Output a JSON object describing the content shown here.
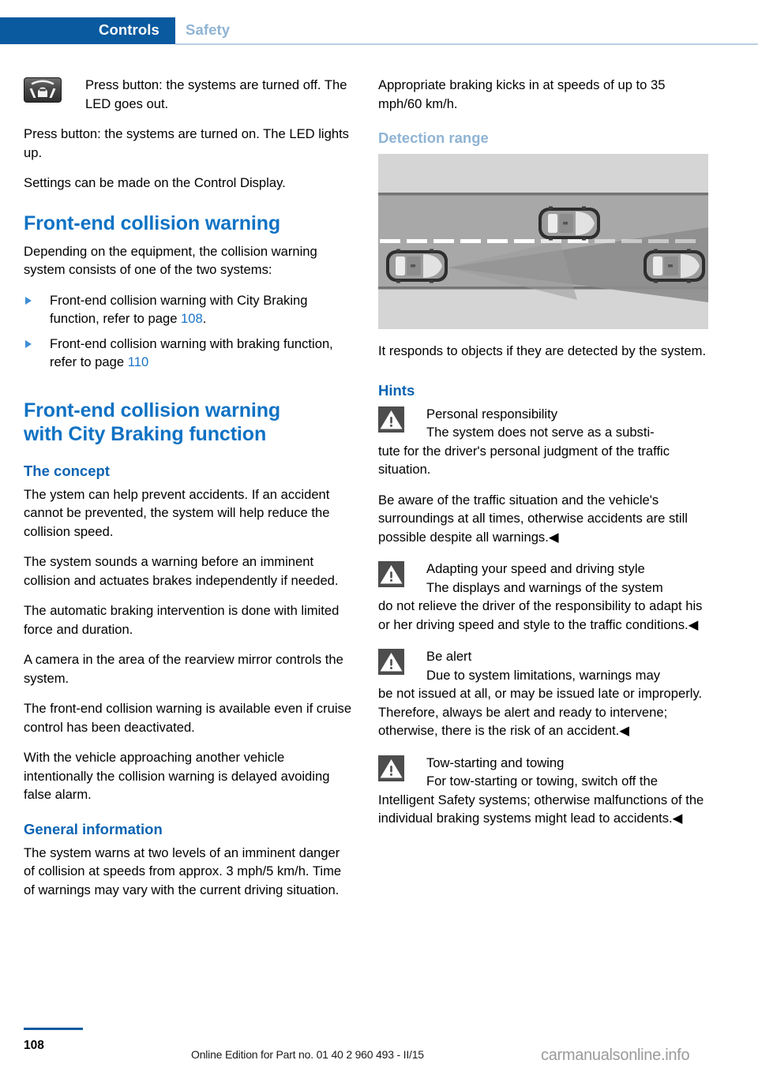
{
  "header": {
    "tab_active": "Controls",
    "tab_inactive": "Safety",
    "accent_color": "#0a5aa0",
    "inactive_color": "#8fb4d4"
  },
  "left_column": {
    "button_icon_name": "lane-departure-button-icon",
    "button_paragraph": "Press button: the systems are turned off. The LED goes out.",
    "paragraph_on": "Press button: the systems are turned on. The LED lights up.",
    "paragraph_settings": "Settings can be made on the Control Display.",
    "chapter_1": "Front-end collision warning",
    "intro": "Depending on the equipment, the collision warning system consists of one of the two systems:",
    "bullets": [
      {
        "text_before": "Front-end collision warning with City Braking function, refer to page ",
        "page": "108",
        "text_after": "."
      },
      {
        "text_before": "Front-end collision warning with braking function, refer to page ",
        "page": "110",
        "text_after": ""
      }
    ],
    "chapter_2_line1": "Front-end collision warning",
    "chapter_2_line2": "with City Braking function",
    "section_concept": "The concept",
    "concept_p1": "The ystem can help prevent accidents. If an accident cannot be prevented, the system will help reduce the collision speed.",
    "concept_p2": "The system sounds a warning before an imminent collision and actuates brakes independently if needed.",
    "concept_p3": "The automatic braking intervention is done with limited force and duration.",
    "concept_p4": "A camera in the area of the rearview mirror controls the system.",
    "concept_p5": "The front-end collision warning is available even if cruise control has been deactivated.",
    "concept_p6": "With the vehicle approaching another vehicle intentionally the collision warning is delayed avoiding false alarm.",
    "section_general": "General information",
    "general_p1": "The system warns at two levels of an imminent danger of collision at speeds from approx. 3 mph/5 km/h. Time of warnings may vary with the current driving situation."
  },
  "right_column": {
    "braking_speed": "Appropriate braking kicks in at speeds of up to 35 mph/60 km/h.",
    "section_detection": "Detection range",
    "illustration_name": "detection-range-illustration",
    "detection_caption": "It responds to objects if they are detected by the system.",
    "section_hints": "Hints",
    "warnings": [
      {
        "title": "Personal responsibility",
        "body_first": "The system does not serve as a substi-",
        "body_rest": "tute for the driver's personal judgment of the traffic situation.",
        "extra": "Be aware of the traffic situation and the vehicle's surroundings at all times, otherwise accidents are still possible despite all warnings.◀"
      },
      {
        "title": "Adapting your speed and driving style",
        "body_first": "The displays and warnings of the system",
        "body_rest": "do not relieve the driver of the responsibility to adapt his or her driving speed and style to the traffic conditions.◀",
        "extra": ""
      },
      {
        "title": "Be alert",
        "body_first": "Due to system limitations, warnings may",
        "body_rest": "be not issued at all, or may be issued late or improperly. Therefore, always be alert and ready to intervene; otherwise, there is the risk of an accident.◀",
        "extra": ""
      },
      {
        "title": "Tow-starting and towing",
        "body_first": "For tow-starting or towing, switch off the",
        "body_rest": "Intelligent Safety systems; otherwise malfunctions of the individual braking systems might lead to accidents.◀",
        "extra": ""
      }
    ]
  },
  "footer": {
    "page_number": "108",
    "edition_text": "Online Edition for Part no. 01 40 2 960 493 - II/15",
    "watermark": "carmanualsonline.info"
  }
}
